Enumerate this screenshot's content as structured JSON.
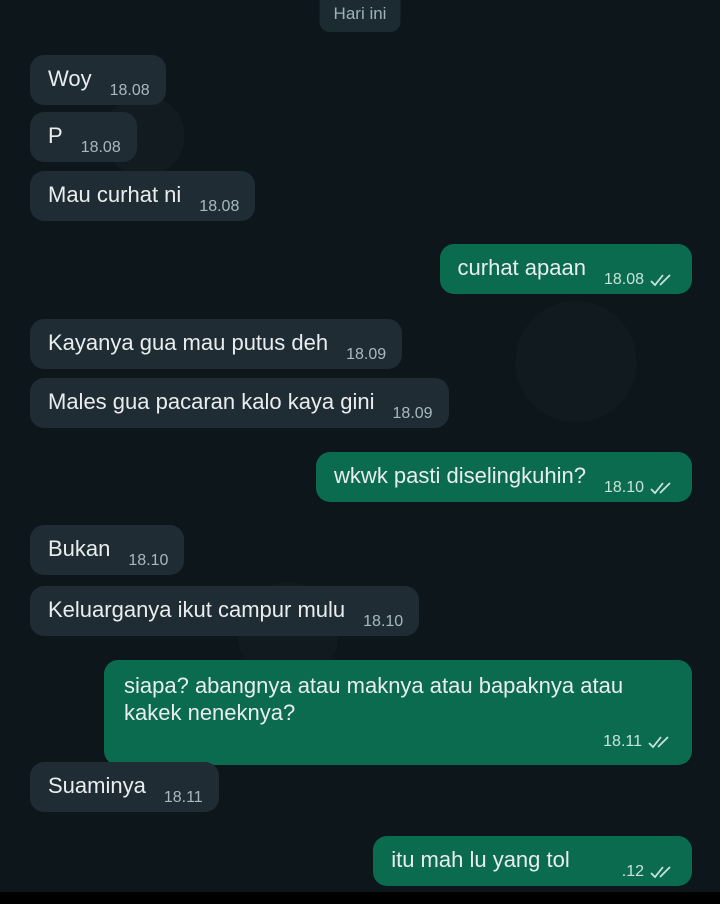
{
  "date_header": "Hari ini",
  "messages": [
    {
      "dir": "in",
      "text": "Woy",
      "time": "18.08"
    },
    {
      "dir": "in",
      "text": "P",
      "time": "18.08"
    },
    {
      "dir": "in",
      "text": "Mau curhat ni",
      "time": "18.08"
    },
    {
      "dir": "out",
      "text": "curhat apaan",
      "time": "18.08"
    },
    {
      "dir": "in",
      "text": "Kayanya gua mau putus deh",
      "time": "18.09"
    },
    {
      "dir": "in",
      "text": "Males gua pacaran kalo kaya gini",
      "time": "18.09"
    },
    {
      "dir": "out",
      "text": "wkwk pasti diselingkuhin?",
      "time": "18.10"
    },
    {
      "dir": "in",
      "text": "Bukan",
      "time": "18.10"
    },
    {
      "dir": "in",
      "text": "Keluarganya ikut campur mulu",
      "time": "18.10"
    },
    {
      "dir": "out",
      "text": "siapa? abangnya atau maknya atau bapaknya atau kakek neneknya?",
      "time": "18.11"
    },
    {
      "dir": "in",
      "text": "Suaminya",
      "time": "18.11"
    },
    {
      "dir": "out",
      "text": "itu mah lu yang tol",
      "time": ".12"
    }
  ],
  "colors": {
    "background": "#0c161b",
    "incoming_bubble": "#1f2c34",
    "outgoing_bubble": "#0a6b4f"
  },
  "icons": {
    "read_receipt": "double-check-icon"
  }
}
